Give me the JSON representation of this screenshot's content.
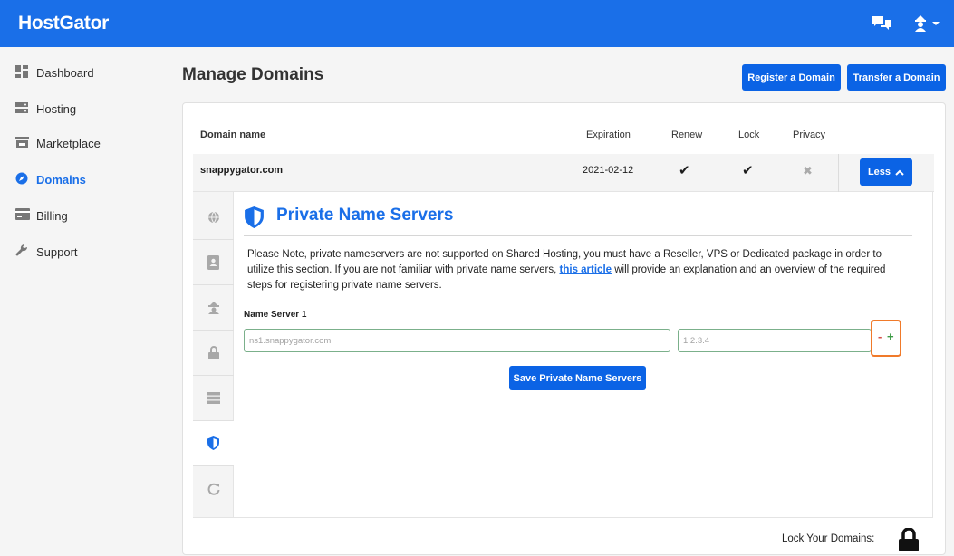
{
  "header": {
    "brand": "HostGator"
  },
  "sidebar": {
    "items": [
      {
        "label": "Dashboard",
        "icon": "dashboard-icon"
      },
      {
        "label": "Hosting",
        "icon": "server-icon"
      },
      {
        "label": "Marketplace",
        "icon": "store-icon"
      },
      {
        "label": "Domains",
        "icon": "compass-icon",
        "active": true
      },
      {
        "label": "Billing",
        "icon": "credit-card-icon"
      },
      {
        "label": "Support",
        "icon": "wrench-icon"
      }
    ]
  },
  "main": {
    "title": "Manage Domains",
    "register_button": "Register a Domain",
    "transfer_button": "Transfer a Domain"
  },
  "table": {
    "columns": {
      "domain": "Domain name",
      "expiration": "Expiration",
      "renew": "Renew",
      "lock": "Lock",
      "privacy": "Privacy"
    },
    "row": {
      "domain": "snappygator.com",
      "expiration": "2021-02-12",
      "renew": "✔",
      "lock": "✔",
      "privacy": "✖",
      "toggle_label": "Less"
    }
  },
  "panel": {
    "title": "Private Name Servers",
    "note_before": "Please Note, private nameservers are not supported on Shared Hosting, you must have a Reseller, VPS or Dedicated package in order to utilize this section. If you are not familiar with private name servers, ",
    "note_link": "this article",
    "note_after": " will provide an explanation and an overview of the required steps for registering private name servers.",
    "field_label": "Name Server 1",
    "host_placeholder": "ns1.snappygator.com",
    "ip_placeholder": "1.2.3.4",
    "minus": "-",
    "plus": "+",
    "save_button": "Save Private Name Servers"
  },
  "footer": {
    "lock_label": "Lock Your Domains:"
  },
  "colors": {
    "brand": "#1a6fe8",
    "button": "#0b63e5",
    "highlight": "#f07a2a",
    "minus": "#d4524a",
    "plus": "#3c9b45"
  }
}
